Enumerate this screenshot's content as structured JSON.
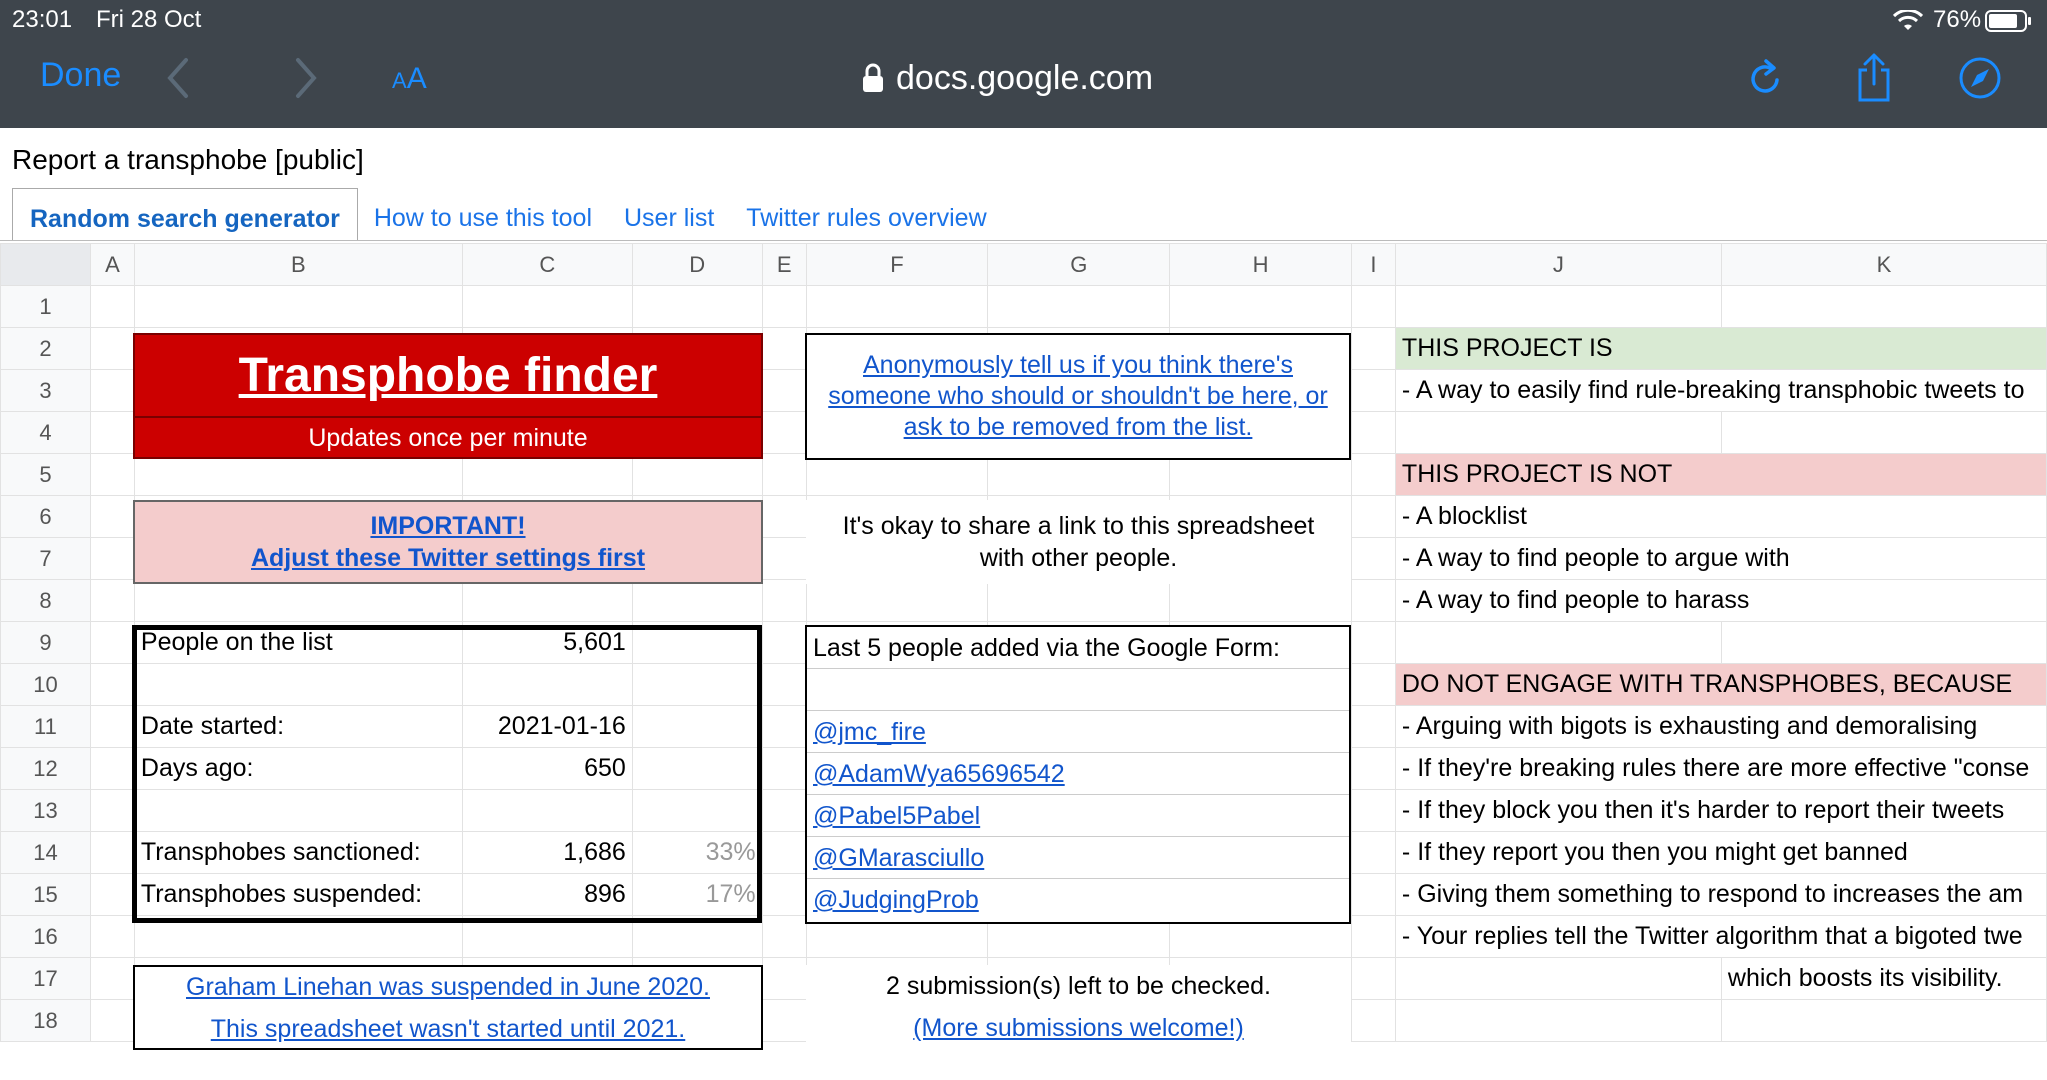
{
  "status_bar": {
    "time": "23:01",
    "date": "Fri 28 Oct",
    "battery": "76%"
  },
  "browser": {
    "done_label": "Done",
    "aa_small": "A",
    "aa_large": "A",
    "url": "docs.google.com"
  },
  "doc": {
    "title": "Report a transphobe [public]"
  },
  "tabs": [
    {
      "label": "Random search generator",
      "active": true
    },
    {
      "label": "How to use this tool"
    },
    {
      "label": "User list"
    },
    {
      "label": "Twitter rules overview"
    }
  ],
  "columns": [
    "A",
    "B",
    "C",
    "D",
    "E",
    "F",
    "G",
    "H",
    "I",
    "J",
    "K"
  ],
  "rows": [
    "1",
    "2",
    "3",
    "4",
    "5",
    "6",
    "7",
    "8",
    "9",
    "10",
    "11",
    "12",
    "13",
    "14",
    "15",
    "16",
    "17",
    "18"
  ],
  "finder": {
    "title": "Transphobe finder",
    "subtitle": "Updates once per minute"
  },
  "important": {
    "line1": "IMPORTANT!",
    "line2": "Adjust these Twitter settings first"
  },
  "stats": {
    "people_label": "People on the list",
    "people_value": "5,601",
    "date_label": "Date started:",
    "date_value": "2021-01-16",
    "days_label": "Days ago:",
    "days_value": "650",
    "sanctioned_label": "Transphobes sanctioned:",
    "sanctioned_value": "1,686",
    "sanctioned_pct": "33%",
    "suspended_label": "Transphobes suspended:",
    "suspended_value": "896",
    "suspended_pct": "17%"
  },
  "anon": {
    "line1": "Anonymously tell us if you think there's",
    "line2": "someone who should or shouldn't be here, or",
    "line3": "ask to be removed from the list."
  },
  "share": {
    "line1": "It's okay to share a link to this spreadsheet",
    "line2": "with other people."
  },
  "recent": {
    "header": "Last 5 people added via the Google Form:",
    "users": [
      "@jmc_fire",
      "@AdamWya65696542",
      "@Pabel5Pabel",
      "@GMarasciullo",
      "@JudgingProb"
    ]
  },
  "graham": {
    "line1": "Graham Linehan was suspended in June 2020.",
    "line2": "This spreadsheet wasn't started until 2021."
  },
  "submissions": {
    "line1": "2 submission(s) left to be checked.",
    "line2": "(More submissions welcome!)"
  },
  "project": {
    "is_header": "THIS PROJECT IS",
    "is_1": "- A way to easily find rule-breaking transphobic tweets to",
    "not_header": "THIS PROJECT IS NOT",
    "not_1": "- A blocklist",
    "not_2": "- A way to find people to argue with",
    "not_3": "- A way to find people to harass",
    "engage_header": "DO NOT ENGAGE WITH TRANSPHOBES, BECAUSE",
    "engage_1": "- Arguing with bigots is exhausting and demoralising",
    "engage_2": "- If they're breaking rules there are more effective \"conse",
    "engage_3": "- If they block you then it's harder to report their tweets",
    "engage_4": "- If they report you then you might get banned",
    "engage_5": "- Giving them something to respond to increases the am",
    "engage_6": "- Your replies tell the Twitter algorithm that a bigoted twe",
    "engage_7": "which boosts its visibility."
  },
  "colors": {
    "chrome": "#3e454c",
    "ios_blue": "#1a8cff",
    "finder_red": "#cc0000",
    "pink": "#f4cccc",
    "green": "#d9ead3",
    "link": "#1155cc"
  }
}
